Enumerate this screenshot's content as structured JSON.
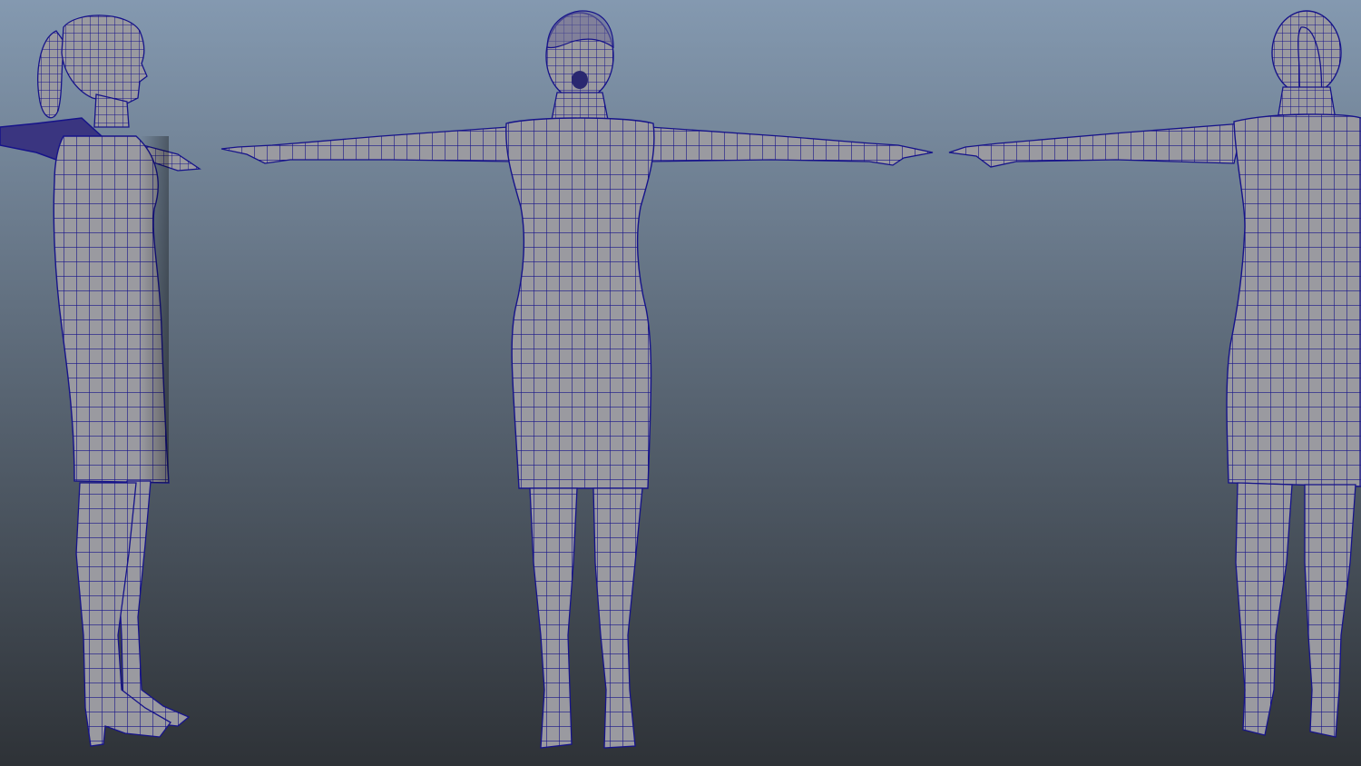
{
  "viewport": {
    "background_top": "#8499b0",
    "background_bottom": "#2e3237"
  },
  "mesh": {
    "surface_color": "#9a9aa0",
    "wire_color": "#16138a",
    "shadow_color": "#5c5c66"
  },
  "views": [
    {
      "name": "side"
    },
    {
      "name": "front"
    },
    {
      "name": "back"
    }
  ]
}
